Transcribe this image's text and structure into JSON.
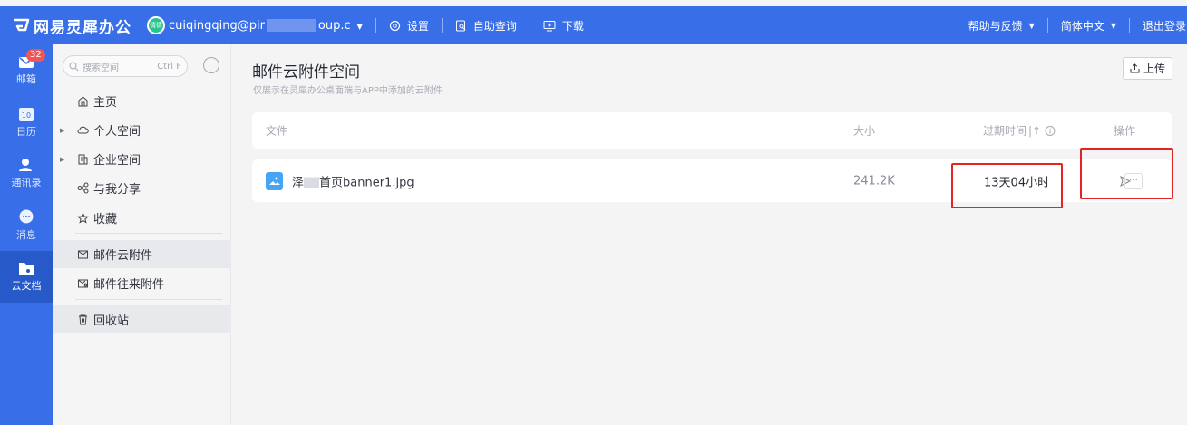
{
  "header": {
    "app_name": "网易灵犀办公",
    "avatar_text": "情情",
    "account_prefix": "cuiqingqing@pir",
    "account_suffix": "oup.c",
    "settings": "设置",
    "self_service": "自助查询",
    "download": "下载",
    "help": "帮助与反馈",
    "language": "简体中文",
    "logout": "退出登录"
  },
  "nav": {
    "mail": "邮箱",
    "mail_badge": "32",
    "calendar": "日历",
    "calendar_day": "10",
    "contacts": "通讯录",
    "messages": "消息",
    "cloud_docs": "云文档"
  },
  "sidebar": {
    "search_placeholder": "搜索空间",
    "shortcut": "Ctrl F",
    "home": "主页",
    "personal": "个人空间",
    "enterprise": "企业空间",
    "shared": "与我分享",
    "favorites": "收藏",
    "mail_cloud": "邮件云附件",
    "mail_attachments": "邮件往来附件",
    "recycle": "回收站"
  },
  "main": {
    "title": "邮件云附件空间",
    "subtitle": "仅展示在灵犀办公桌面端与APP中添加的云附件",
    "upload": "上传",
    "columns": {
      "file": "文件",
      "size": "大小",
      "expiry": "过期时间",
      "operation": "操作"
    },
    "rows": [
      {
        "name_prefix": "泽",
        "name_suffix": "首页banner1.jpg",
        "size": "241.2K",
        "expiry": "13天04小时"
      }
    ]
  },
  "colors": {
    "brand_blue": "#386ee7",
    "highlight_red": "#e32424",
    "sidebar_bg": "#f5f5f6"
  }
}
